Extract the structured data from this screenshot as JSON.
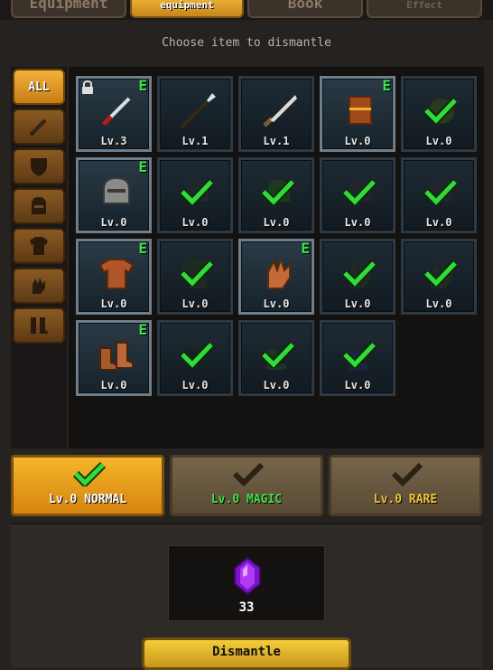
{
  "tabs": [
    {
      "label": "Equipment",
      "active": false
    },
    {
      "label": "equipment",
      "active": true
    },
    {
      "label": "Book",
      "active": false
    },
    {
      "label": "Effect",
      "active": false
    }
  ],
  "instruction": "Choose item to dismantle",
  "filters": [
    {
      "label": "ALL",
      "icon": "all",
      "active": true
    },
    {
      "label": "",
      "icon": "sword-icon"
    },
    {
      "label": "",
      "icon": "shield-icon"
    },
    {
      "label": "",
      "icon": "helmet-icon"
    },
    {
      "label": "",
      "icon": "armor-icon"
    },
    {
      "label": "",
      "icon": "gloves-icon"
    },
    {
      "label": "",
      "icon": "boots-icon"
    }
  ],
  "slots": [
    {
      "level": "Lv.3",
      "item": "red-dagger-icon",
      "equipped": true,
      "locked": true,
      "selected": false
    },
    {
      "level": "Lv.1",
      "item": "spear-icon",
      "equipped": false,
      "locked": false,
      "selected": false
    },
    {
      "level": "Lv.1",
      "item": "broadsword-icon",
      "equipped": false,
      "locked": false,
      "selected": false
    },
    {
      "level": "Lv.0",
      "item": "wooden-shield-icon",
      "equipped": true,
      "locked": false,
      "selected": false
    },
    {
      "level": "Lv.0",
      "item": "green-shield-icon",
      "equipped": false,
      "locked": false,
      "selected": true
    },
    {
      "level": "Lv.0",
      "item": "iron-helmet-icon",
      "equipped": true,
      "locked": false,
      "selected": false
    },
    {
      "level": "Lv.0",
      "item": "helmet-icon",
      "equipped": false,
      "locked": false,
      "selected": true
    },
    {
      "level": "Lv.0",
      "item": "green-helmet-icon",
      "equipped": false,
      "locked": false,
      "selected": true
    },
    {
      "level": "Lv.0",
      "item": "helmet-icon",
      "equipped": false,
      "locked": false,
      "selected": true
    },
    {
      "level": "Lv.0",
      "item": "helmet-icon",
      "equipped": false,
      "locked": false,
      "selected": true
    },
    {
      "level": "Lv.0",
      "item": "leather-armor-icon",
      "equipped": true,
      "locked": false,
      "selected": false
    },
    {
      "level": "Lv.0",
      "item": "armor-icon",
      "equipped": false,
      "locked": false,
      "selected": true
    },
    {
      "level": "Lv.0",
      "item": "leather-gloves-icon",
      "equipped": true,
      "locked": false,
      "selected": false
    },
    {
      "level": "Lv.0",
      "item": "gloves-icon",
      "equipped": false,
      "locked": false,
      "selected": true
    },
    {
      "level": "Lv.0",
      "item": "gloves-icon",
      "equipped": false,
      "locked": false,
      "selected": true
    },
    {
      "level": "Lv.0",
      "item": "leather-boots-icon",
      "equipped": true,
      "locked": false,
      "selected": false
    },
    {
      "level": "Lv.0",
      "item": "boots-icon",
      "equipped": false,
      "locked": false,
      "selected": true
    },
    {
      "level": "Lv.0",
      "item": "green-boots-icon",
      "equipped": false,
      "locked": false,
      "selected": true
    },
    {
      "level": "Lv.0",
      "item": "blue-boots-icon",
      "equipped": false,
      "locked": false,
      "selected": true
    }
  ],
  "equipped_marker": "E",
  "grades": [
    {
      "label": "Lv.0 NORMAL",
      "active": true,
      "color": "#f2a51c",
      "text_color": "#ffffff"
    },
    {
      "label": "Lv.0 MAGIC",
      "active": false,
      "color": "#6a5a3c",
      "text_color": "#43e04a"
    },
    {
      "label": "Lv.0 RARE",
      "active": false,
      "color": "#6a5a3c",
      "text_color": "#f2c23a"
    }
  ],
  "cost": {
    "icon": "purple-gem-icon",
    "value": "33"
  },
  "dismantle_label": "Dismantle",
  "colors": {
    "check": "#2fdc3a",
    "equipped": "#37e34a",
    "accent": "#f2b23a",
    "gem": "#a22ef0"
  }
}
